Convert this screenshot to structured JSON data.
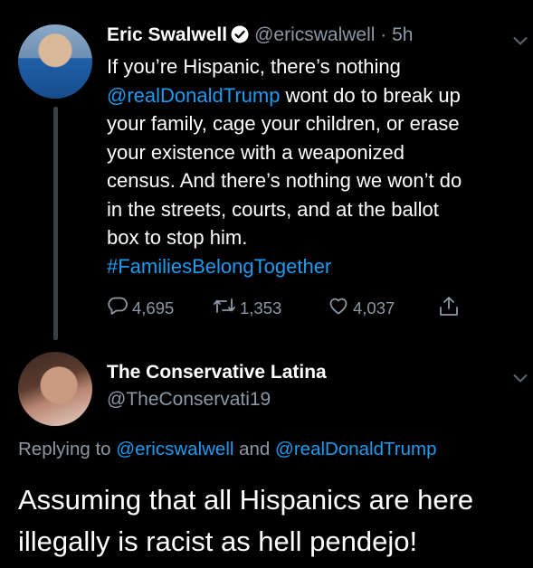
{
  "tweet": {
    "author_name": "Eric Swalwell",
    "author_handle": "@ericswalwell",
    "separator": " · ",
    "time": "5h",
    "lines": [
      {
        "text": "If you’re Hispanic, there’s nothing"
      },
      {
        "mention": "@realDonaldTrump",
        "text": " wont do to break up"
      },
      {
        "text": "your family, cage your children, or erase"
      },
      {
        "text": "your existence with a weaponized"
      },
      {
        "text": "census. And there’s nothing we won’t do"
      },
      {
        "text": "in the streets, courts, and at the ballot"
      },
      {
        "text": "box to stop him."
      },
      {
        "hashtag": "#FamiliesBelongTogether"
      }
    ],
    "reply_count": "4,695",
    "retweet_count": "1,353",
    "like_count": "4,037"
  },
  "reply": {
    "author_name": "The Conservative Latina",
    "author_handle": "@TheConservati19",
    "replying_prefix": "Replying to ",
    "replying_to_1": "@ericswalwell",
    "replying_and": " and ",
    "replying_to_2": "@realDonaldTrump",
    "text_line1": "Assuming that all Hispanics are here",
    "text_line2": "illegally is racist as hell pendejo!"
  },
  "icons": {
    "verified": "verified-badge-icon",
    "reply": "reply-icon",
    "retweet": "retweet-icon",
    "like": "heart-icon",
    "share": "share-icon",
    "more": "chevron-down-icon"
  },
  "colors": {
    "background": "#000000",
    "text": "#ffffff",
    "secondary": "#8b98a5",
    "link": "#1d9bf0"
  }
}
